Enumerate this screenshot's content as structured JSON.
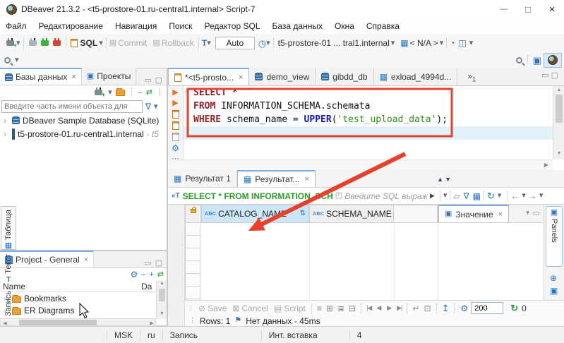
{
  "window": {
    "title": "DBeaver 21.3.2 - <t5-prostore-01.ru-central1.internal> Script-7"
  },
  "menubar": {
    "items": [
      "Файл",
      "Редактирование",
      "Навигация",
      "Поиск",
      "Редактор SQL",
      "База данных",
      "Окна",
      "Справка"
    ]
  },
  "toolbar": {
    "sql_label": "SQL",
    "commit_label": "Commit",
    "rollback_label": "Rollback",
    "tx_mode": "Auto",
    "connection": "t5-prostore-01 ... tral1.internal",
    "database": "< N/A >"
  },
  "db_panel": {
    "tab_databases": "Базы данных",
    "tab_projects": "Проекты",
    "filter_placeholder": "Введите часть имени объекта для",
    "tree": [
      {
        "label": "DBeaver Sample Database (SQLite)",
        "suffix": ""
      },
      {
        "label": "t5-prostore-01.ru-central1.internal",
        "suffix": "- t5"
      }
    ]
  },
  "project_panel": {
    "title": "Project - General",
    "columns": [
      "Name",
      "Da"
    ],
    "items": [
      "Bookmarks",
      "ER Diagrams"
    ]
  },
  "editor": {
    "tabs": [
      "*<t5-prosto...",
      "demo_view",
      "gibdd_db",
      "exload_4994d..."
    ],
    "overflow_count": "1",
    "sql_lines": [
      [
        {
          "t": "SELECT",
          "c": "kw"
        },
        {
          "t": " *",
          "c": "pl"
        }
      ],
      [
        {
          "t": "FROM",
          "c": "kw"
        },
        {
          "t": " INFORMATION_SCHEMA.schemata",
          "c": "pl"
        }
      ],
      [
        {
          "t": "WHERE",
          "c": "kw"
        },
        {
          "t": " schema_name = ",
          "c": "pl"
        },
        {
          "t": "UPPER",
          "c": "fn"
        },
        {
          "t": "(",
          "c": "pl"
        },
        {
          "t": "'test_upload_data'",
          "c": "str"
        },
        {
          "t": ");",
          "c": "pl"
        }
      ]
    ]
  },
  "results": {
    "tab1": "Результат 1",
    "tab2": "Результат...",
    "filter_text": "SELECT * FROM INFORMATION_SCH",
    "filter_placeholder": "Введите SQL выраж",
    "side_tabs": [
      "Таблица",
      "Текст",
      "Запись"
    ],
    "grid": {
      "type_prefix": "ABC",
      "columns": [
        "CATALOG_NAME",
        "SCHEMA_NAME"
      ]
    },
    "value_panel": "Значение",
    "panels_label": "Panels",
    "footer": {
      "save": "Save",
      "cancel": "Cancel",
      "script": "Script",
      "fetch_size": "200",
      "refresh_count": "0"
    },
    "status": {
      "rows": "Rows: 1",
      "message": "Нет данных - 45ms"
    }
  },
  "statusbar": {
    "tz": "MSK",
    "lang": "ru",
    "mode": "Запись",
    "insert_mode": "Инт. вставка",
    "position": "4"
  },
  "icons": {
    "dropdown": "▾",
    "overflow": "»",
    "minimize": "—",
    "maximize": "□",
    "close": "×",
    "panel_min": "▭",
    "panel_max": "▢",
    "chevron": "›",
    "up": "▲",
    "down": "▼",
    "left_tri": "◀",
    "right_tri": "▶",
    "plus": "+",
    "collapse": "‒",
    "link": "⇄",
    "menu": "⋮",
    "dots": "⋯",
    "gear": "⚙",
    "history": "◷",
    "gauge": "◔",
    "network": "◫",
    "table": "▦",
    "value_panel": "▣",
    "circle_plus": "⊕",
    "checker": "▩",
    "run": "▶",
    "funnel": "∇",
    "sort": "⇅",
    "expand": "◰",
    "eraser": "▱",
    "refresh": "↻",
    "back": "←",
    "forward": "→",
    "upload": "↥",
    "save": "⊘",
    "cancel": "⊠",
    "script_glyph": "▤",
    "row_edit": "≡",
    "row_add": "⊞",
    "row_copy": "≣",
    "row_del": "⊟",
    "nav_first": "|◀",
    "nav_prev": "◀",
    "nav_next": "▶",
    "nav_last": "▶|",
    "goto": "↵",
    "focus": "⊡",
    "flag": "⚑",
    "fold": "⊝",
    "sql_text": "«T"
  },
  "colors": {
    "annotation": "#e8402a",
    "keyword": "#9b2123",
    "function": "#1414c8",
    "string": "#2f9117",
    "filter_text": "#2aa12a",
    "header_selected": "#cde6f7",
    "accent": "#2675bf"
  }
}
